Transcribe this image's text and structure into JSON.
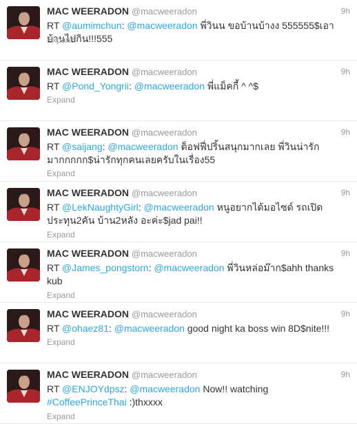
{
  "tweets": [
    {
      "name": "MAC WEERADON",
      "handle": "@macweeradon",
      "time": "9h",
      "parts": [
        {
          "t": "text",
          "v": "RT "
        },
        {
          "t": "mention",
          "v": "@aumimchun"
        },
        {
          "t": "text",
          "v": ": "
        },
        {
          "t": "mention",
          "v": "@macweeradon"
        },
        {
          "t": "text",
          "v": " พี่วินน ขอบ้านบ้างง 555555$เอาบ้านไปกิน!!!555"
        }
      ],
      "expand": "Expand"
    },
    {
      "name": "MAC WEERADON",
      "handle": "@macweeradon",
      "time": "9h",
      "parts": [
        {
          "t": "text",
          "v": "RT "
        },
        {
          "t": "mention",
          "v": "@Pond_Yongrii"
        },
        {
          "t": "text",
          "v": ": "
        },
        {
          "t": "mention",
          "v": "@macweeradon"
        },
        {
          "t": "text",
          "v": " พี่แม็คกี้ ^ ^$"
        }
      ],
      "expand": "Expand"
    },
    {
      "name": "MAC WEERADON",
      "handle": "@macweeradon",
      "time": "9h",
      "parts": [
        {
          "t": "text",
          "v": "RT "
        },
        {
          "t": "mention",
          "v": "@saijang"
        },
        {
          "t": "text",
          "v": ": "
        },
        {
          "t": "mention",
          "v": "@macweeradon"
        },
        {
          "t": "text",
          "v": " ต็อฟฟี่ปริ้นสนุกมากเลย พี่วินน่ารักมากกกกก$น่ารักทุกคนเลยครับในเรื่อง55"
        }
      ],
      "expand": "Expand"
    },
    {
      "name": "MAC WEERADON",
      "handle": "@macweeradon",
      "time": "9h",
      "parts": [
        {
          "t": "text",
          "v": "RT "
        },
        {
          "t": "mention",
          "v": "@LekNaughtyGirl"
        },
        {
          "t": "text",
          "v": ": "
        },
        {
          "t": "mention",
          "v": "@macweeradon"
        },
        {
          "t": "text",
          "v": " หนูอยากได้มอไซด์ รถเปิดประทุน2คัน บ้าน2หลัง อะค่ะ$jad pai!!"
        }
      ],
      "expand": "Expand"
    },
    {
      "name": "MAC WEERADON",
      "handle": "@macweeradon",
      "time": "9h",
      "parts": [
        {
          "t": "text",
          "v": "RT "
        },
        {
          "t": "mention",
          "v": "@James_pongstorn"
        },
        {
          "t": "text",
          "v": ": "
        },
        {
          "t": "mention",
          "v": "@macweeradon"
        },
        {
          "t": "text",
          "v": " พี่วินหล่อม๊าก$ahh thanks kub"
        }
      ],
      "expand": "Expand"
    },
    {
      "name": "MAC WEERADON",
      "handle": "@macweeradon",
      "time": "9h",
      "parts": [
        {
          "t": "text",
          "v": "RT "
        },
        {
          "t": "mention",
          "v": "@ohaez81"
        },
        {
          "t": "text",
          "v": ": "
        },
        {
          "t": "mention",
          "v": "@macweeradon"
        },
        {
          "t": "text",
          "v": " good night ka boss win 8D$nite!!!"
        }
      ],
      "expand": "Expand"
    },
    {
      "name": "MAC WEERADON",
      "handle": "@macweeradon",
      "time": "9h",
      "parts": [
        {
          "t": "text",
          "v": "RT "
        },
        {
          "t": "mention",
          "v": "@ENJOYdpsz"
        },
        {
          "t": "text",
          "v": ": "
        },
        {
          "t": "mention",
          "v": "@macweeradon"
        },
        {
          "t": "text",
          "v": " Now!! watching "
        },
        {
          "t": "hashtag",
          "v": "#CoffeePrinceThai"
        },
        {
          "t": "text",
          "v": " :)thxxxx"
        }
      ],
      "expand": "Expand"
    }
  ]
}
